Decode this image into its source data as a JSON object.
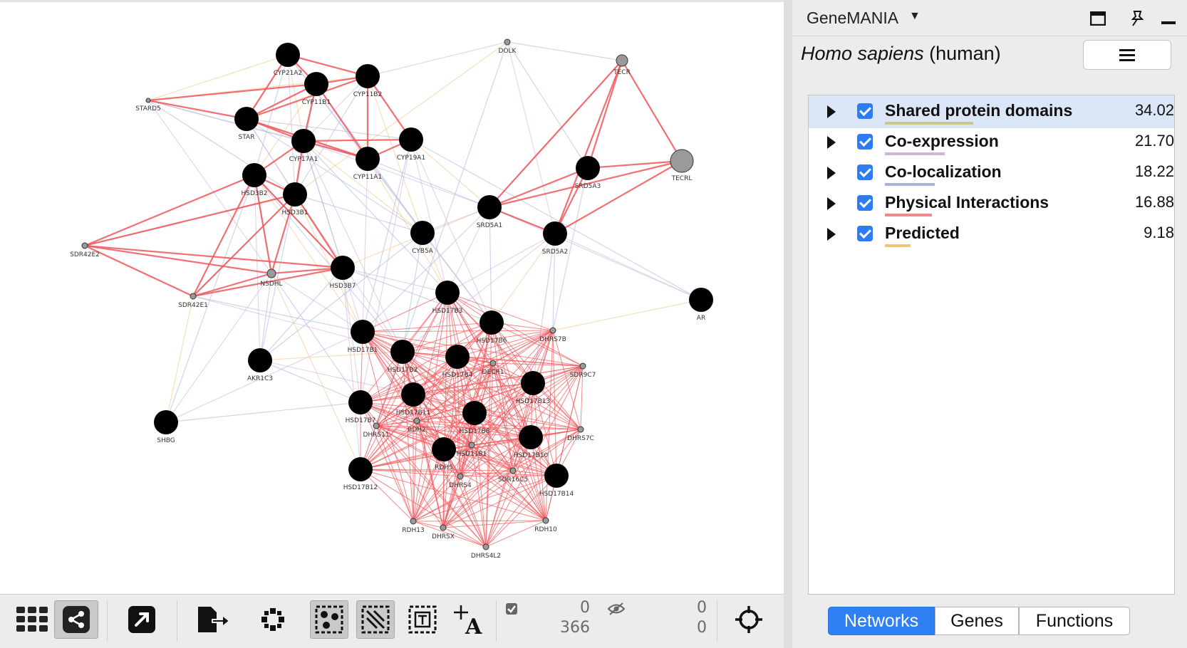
{
  "network": {
    "labels": {
      "CYP21A2": "CYP21A2",
      "CYP11B1": "CYP11B1",
      "CYP11B2": "CYP11B2",
      "STARD5": "STARD5",
      "STAR": "STAR",
      "CYP17A1": "CYP17A1",
      "CYP11A1": "CYP11A1",
      "CYP19A1": "CYP19A1",
      "DOLK": "DOLK",
      "TECR": "TECR",
      "TECRL": "TECRL",
      "SRD5A3": "SRD5A3",
      "SRD5A1": "SRD5A1",
      "SRD5A2": "SRD5A2",
      "CYB5A": "CYB5A",
      "HSD3B2": "HSD3B2",
      "HSD3B1": "HSD3B1",
      "SDR42E2": "SDR42E2",
      "NSDHL": "NSDHL",
      "HSD3B7": "HSD3B7",
      "SDR42E1": "SDR42E1",
      "AR": "AR",
      "HSD17B3": "HSD17B3",
      "HSD17B6": "HSD17B6",
      "DHRS7B": "DHRS7B",
      "HSD17B1": "HSD17B1",
      "HSD17B2": "HSD17B2",
      "HSD17B4": "HSD17B4",
      "DECR1": "DECR1",
      "SDR9C7": "SDR9C7",
      "AKR1C3": "AKR1C3",
      "HSD17B13": "HSD17B13",
      "HSD17B7": "HSD17B7",
      "HSD17B11": "HSD17B11",
      "BDH2": "BDH2",
      "HSD17B8": "HSD17B8",
      "DHRS11": "DHRS11",
      "DHRS7C": "DHRS7C",
      "SHBG": "SHBG",
      "RDH5": "RDH5",
      "HSD11B1": "HSD11B1",
      "HSD17B10": "HSD17B10",
      "HSD17B12": "HSD17B12",
      "DHRS4": "DHRS4",
      "SDR16C5": "SDR16C5",
      "HSD17B14": "HSD17B14",
      "RDH13": "RDH13",
      "DHRSX": "DHRSX",
      "RDH10": "RDH10",
      "DHRS4L2": "DHRS4L2"
    }
  },
  "toolbar": {
    "selected_nodes": "0",
    "total_nodes": "366",
    "hidden_nodes": "0",
    "hidden_edges": "0"
  },
  "panel": {
    "title": "GeneMANIA",
    "organism_latin": "Homo sapiens",
    "organism_common": "(human)",
    "networks": [
      {
        "name": "Shared protein domains",
        "weight": "34.02",
        "color": "#c9c98d"
      },
      {
        "name": "Co-expression",
        "weight": "21.70",
        "color": "#cfb3d9"
      },
      {
        "name": "Co-localization",
        "weight": "18.22",
        "color": "#a6b5df"
      },
      {
        "name": "Physical Interactions",
        "weight": "16.88",
        "color": "#f08a8a"
      },
      {
        "name": "Predicted",
        "weight": "9.18",
        "color": "#f4c27f"
      }
    ],
    "tabs": [
      "Networks",
      "Genes",
      "Functions"
    ]
  },
  "colors": {
    "physical": "#f0575b",
    "coexpression": "#cfb3d9",
    "colocalization": "#a6b5df",
    "predicted": "#f4c27f",
    "accent": "#2f80f4"
  }
}
